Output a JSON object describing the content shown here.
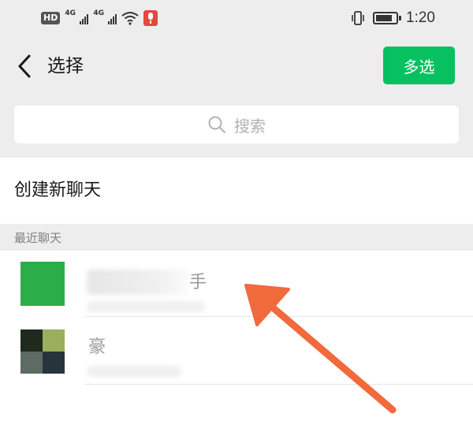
{
  "status_bar": {
    "hd_label": "HD",
    "network_1": "4G",
    "network_2": "4G",
    "time": "1:20"
  },
  "nav": {
    "title": "选择",
    "multi_select_label": "多选"
  },
  "search": {
    "placeholder": "搜索"
  },
  "new_chat_label": "创建新聊天",
  "recent_section_label": "最近聊天",
  "recent_chats": [
    {
      "name_visible_part": "手"
    },
    {
      "name_visible_part": "豪"
    }
  ],
  "colors": {
    "accent_green": "#07c160",
    "background": "#ededed",
    "arrow_annotation": "#f06a3c"
  }
}
